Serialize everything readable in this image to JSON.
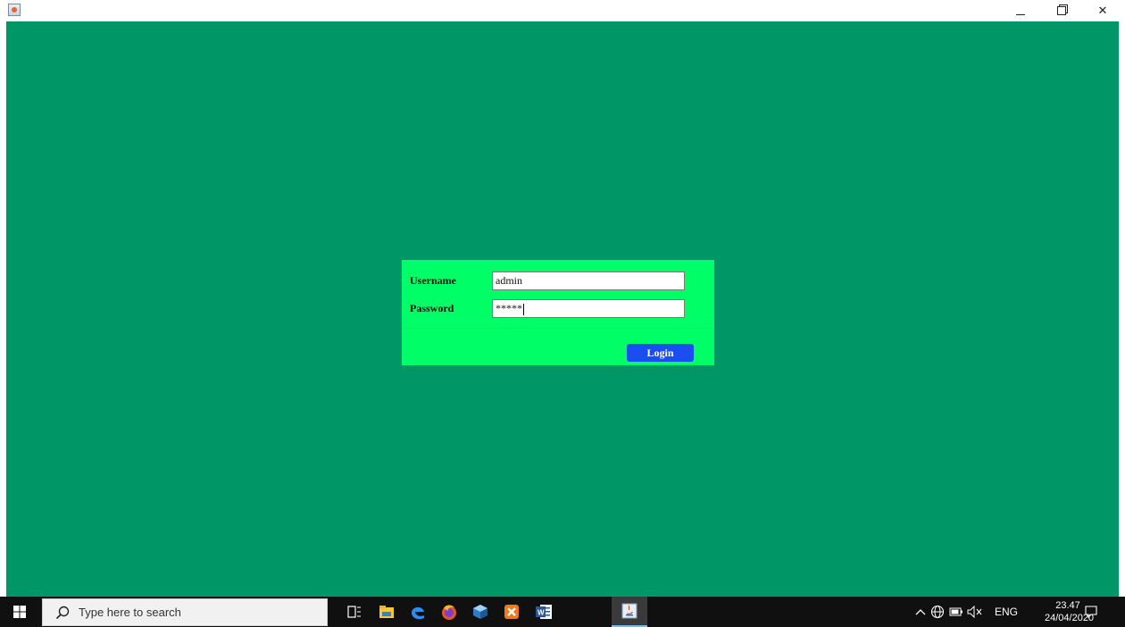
{
  "titlebar": {
    "app_icon": "java-app-icon",
    "minimize_icon": "minimize-icon",
    "restore_icon": "restore-icon",
    "close_glyph": "✕"
  },
  "login": {
    "username_label": "Username",
    "username_value": "admin",
    "password_label": "Password",
    "password_value": "*****",
    "login_button": "Login"
  },
  "taskbar": {
    "search_placeholder": "Type here to search",
    "pinned_apps": [
      "task-view-icon",
      "file-explorer-icon",
      "edge-icon",
      "firefox-icon",
      "virtualbox-icon",
      "xampp-icon",
      "word-icon",
      "java-icon"
    ],
    "tray_language": "ENG",
    "clock_time": "23.47",
    "clock_date": "24/04/2020"
  },
  "colors": {
    "desktop": "#009665",
    "panel": "#00ff66",
    "button": "#1a4ef0",
    "taskbar": "#101010"
  }
}
